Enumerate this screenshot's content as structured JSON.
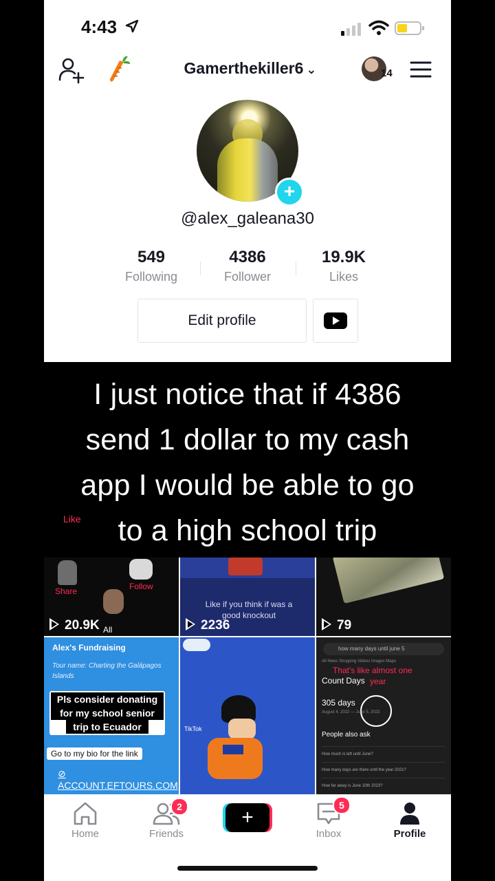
{
  "status": {
    "time": "4:43"
  },
  "header": {
    "username": "Gamerthekiller6",
    "chevron": "⌄",
    "story_count": "14"
  },
  "profile": {
    "handle": "@alex_galeana30",
    "stats": [
      {
        "value": "549",
        "label": "Following"
      },
      {
        "value": "4386",
        "label": "Follower"
      },
      {
        "value": "19.9K",
        "label": "Likes"
      }
    ],
    "edit_label": "Edit profile"
  },
  "caption": {
    "lines": [
      "I just notice that if 4386",
      "send 1 dollar to my cash",
      "app I would be able to go",
      "to a high school trip"
    ],
    "like_tag": "Like"
  },
  "videos": [
    {
      "views": "20.9K",
      "overlay": [
        "Share",
        "Follow",
        "All"
      ]
    },
    {
      "views": "2236",
      "overlay": [
        "Like if you think if was a",
        "good knockout"
      ]
    },
    {
      "views": "79"
    },
    {
      "title": "Alex's Fundraising",
      "subtitle": "Tour name: Charting the Galápagos Islands",
      "message": [
        "Pls consider donating",
        "for my school senior",
        "trip to Ecuador"
      ],
      "bio_note": "Go to my bio for the link",
      "link": "ACCOUNT.EFTOURS.COM"
    },
    {
      "overlay": [
        "TikTok"
      ]
    },
    {
      "search": "how many days until june 5",
      "tabs": "All   News   Shopping   Videos   Images   Maps",
      "note_lines": [
        "That's like almost one",
        "year"
      ],
      "heading": "Count Days",
      "days": "305 days",
      "dates": "August 4, 2022 — June 5, 2023",
      "people_ask": "People also ask",
      "questions": [
        "How much is left until June?",
        "How many days are there until the year 2021?",
        "How far away is June 10th 2023?"
      ]
    }
  ],
  "nav": {
    "items": [
      "Home",
      "Friends",
      "Inbox",
      "Profile"
    ],
    "friends_badge": "2",
    "inbox_badge": "5",
    "create": "+"
  },
  "colors": {
    "accent_red": "#fe2c55",
    "accent_cyan": "#20d5ec"
  }
}
